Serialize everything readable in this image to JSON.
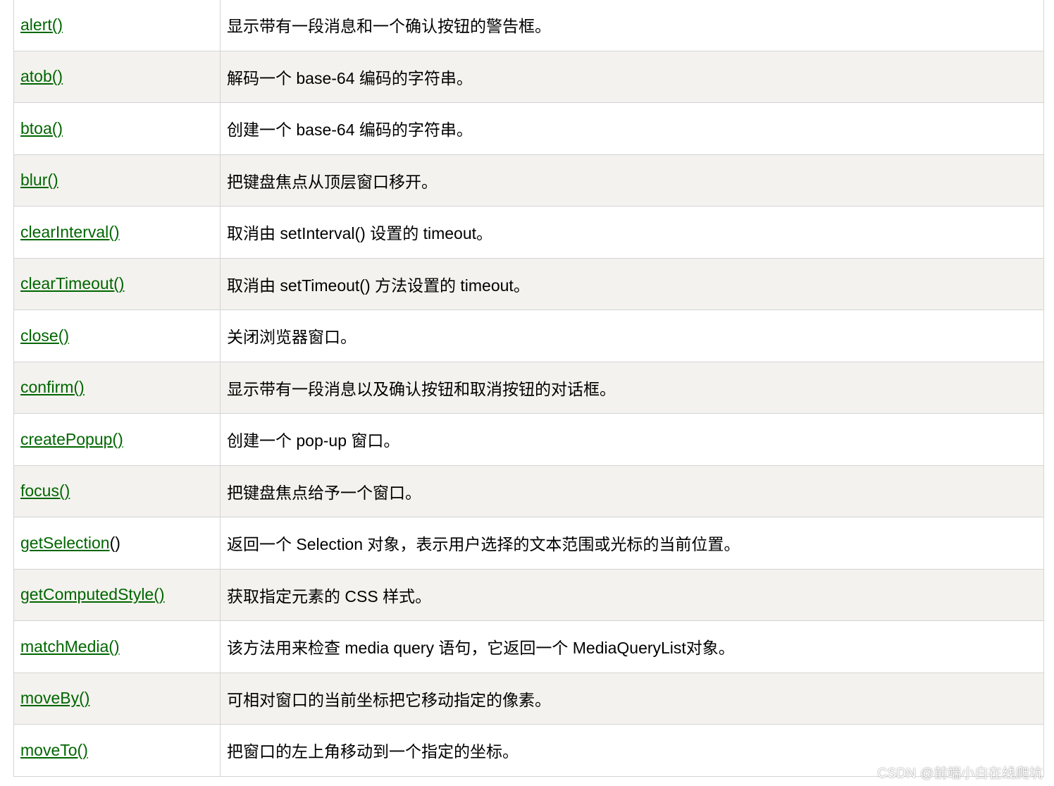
{
  "rows": [
    {
      "method": "alert()",
      "suffix": "",
      "desc": "显示带有一段消息和一个确认按钮的警告框。"
    },
    {
      "method": "atob()",
      "suffix": "",
      "desc": "解码一个 base-64 编码的字符串。"
    },
    {
      "method": "btoa()",
      "suffix": "",
      "desc": "创建一个 base-64 编码的字符串。"
    },
    {
      "method": "blur()",
      "suffix": "",
      "desc": "把键盘焦点从顶层窗口移开。"
    },
    {
      "method": "clearInterval()",
      "suffix": "",
      "desc": "取消由 setInterval() 设置的 timeout。"
    },
    {
      "method": "clearTimeout()",
      "suffix": "",
      "desc": "取消由 setTimeout() 方法设置的 timeout。"
    },
    {
      "method": "close()",
      "suffix": "",
      "desc": "关闭浏览器窗口。"
    },
    {
      "method": "confirm()",
      "suffix": "",
      "desc": "显示带有一段消息以及确认按钮和取消按钮的对话框。"
    },
    {
      "method": "createPopup()",
      "suffix": "",
      "desc": "创建一个 pop-up 窗口。"
    },
    {
      "method": "focus()",
      "suffix": "",
      "desc": "把键盘焦点给予一个窗口。"
    },
    {
      "method": "getSelection",
      "suffix": "()",
      "desc": "返回一个 Selection 对象，表示用户选择的文本范围或光标的当前位置。"
    },
    {
      "method": "getComputedStyle()",
      "suffix": "",
      "desc": "获取指定元素的 CSS 样式。"
    },
    {
      "method": "matchMedia()",
      "suffix": "",
      "desc": "该方法用来检查 media query 语句，它返回一个 MediaQueryList对象。"
    },
    {
      "method": "moveBy()",
      "suffix": "",
      "desc": "可相对窗口的当前坐标把它移动指定的像素。"
    },
    {
      "method": "moveTo()",
      "suffix": "",
      "desc": "把窗口的左上角移动到一个指定的坐标。"
    }
  ],
  "watermark": "CSDN @前端小白在线爬坑"
}
